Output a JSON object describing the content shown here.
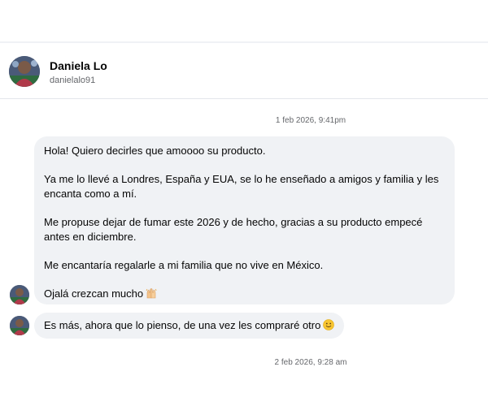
{
  "contact": {
    "name": "Daniela Lo",
    "handle": "danielalo91"
  },
  "timestamps": {
    "first": "1 feb 2026, 9:41pm",
    "second": "2 feb 2026, 9:28 am"
  },
  "messages": {
    "main": {
      "line1": "Hola! Quiero decirles que amoooo su producto.",
      "line2": "Ya me lo llevé a Londres, España y EUA, se lo he enseñado a amigos y familia y les encanta como a mí.",
      "line3": "Me propuse dejar de fumar este 2026 y de hecho, gracias a su producto empecé antes en diciembre.",
      "line4": "Me encantaría regalarle a mi familia que no vive en México.",
      "line5": "Ojalá crezcan mucho",
      "line5_emoji": "raising-hands-icon"
    },
    "second": {
      "text": "Es más, ahora que lo pienso, de una vez les compraré otro",
      "emoji": "smiling-face-icon"
    }
  },
  "colors": {
    "bubble": "#f0f2f5",
    "secondary_text": "#65676b",
    "primary_text": "#050505"
  }
}
